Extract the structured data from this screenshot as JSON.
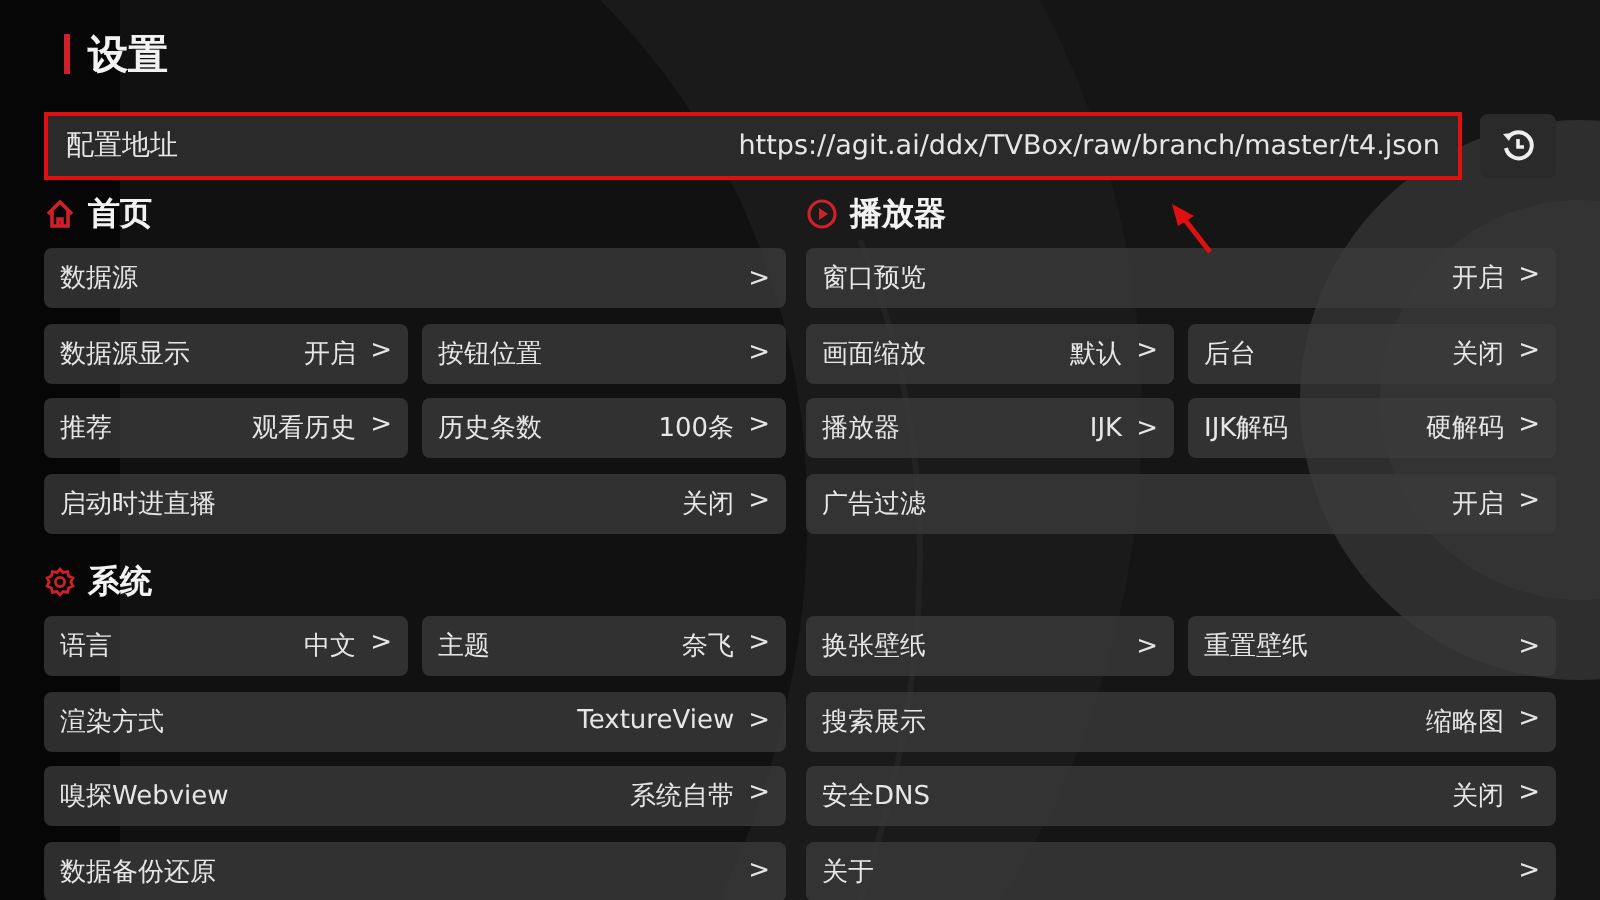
{
  "title": "设置",
  "config": {
    "label": "配置地址",
    "value": "https://agit.ai/ddx/TVBox/raw/branch/master/t4.json",
    "highlighted": true
  },
  "sections": [
    {
      "columns": [
        {
          "heading": {
            "kind": "home",
            "title": "首页"
          },
          "rows": [
            [
              {
                "label": "数据源",
                "arrow": ">"
              }
            ],
            [
              {
                "label": "数据源显示",
                "value": "开启",
                "arrow": ">"
              },
              {
                "label": "按钮位置",
                "arrow": ">"
              }
            ],
            [
              {
                "label": "推荐",
                "value": "观看历史",
                "arrow": ">"
              },
              {
                "label": "历史条数",
                "value": "100条",
                "arrow": ">"
              }
            ],
            [
              {
                "label": "启动时进直播",
                "value": "关闭",
                "arrow": ">"
              }
            ]
          ]
        },
        {
          "heading": {
            "kind": "play",
            "title": "播放器"
          },
          "rows": [
            [
              {
                "label": "窗口预览",
                "value": "开启",
                "arrow": ">"
              }
            ],
            [
              {
                "label": "画面缩放",
                "value": "默认",
                "arrow": ">"
              },
              {
                "label": "后台",
                "value": "关闭",
                "arrow": ">"
              }
            ],
            [
              {
                "label": "播放器",
                "value": "IJK",
                "arrow": ">"
              },
              {
                "label": "IJK解码",
                "value": "硬解码",
                "arrow": ">"
              }
            ],
            [
              {
                "label": "广告过滤",
                "value": "开启",
                "arrow": ">"
              }
            ]
          ]
        }
      ]
    },
    {
      "columns": [
        {
          "heading": {
            "kind": "gear",
            "title": "系统"
          },
          "rows": [
            [
              {
                "label": "语言",
                "value": "中文",
                "arrow": ">"
              },
              {
                "label": "主题",
                "value": "奈飞",
                "arrow": ">"
              }
            ],
            [
              {
                "label": "渲染方式",
                "value": "TextureView",
                "arrow": ">"
              }
            ],
            [
              {
                "label": "嗅探Webview",
                "value": "系统自带",
                "arrow": ">"
              }
            ],
            [
              {
                "label": "数据备份还原",
                "arrow": ">"
              }
            ]
          ]
        },
        {
          "rows": [
            [
              {
                "label": "换张壁纸",
                "arrow": ">"
              },
              {
                "label": "重置壁纸",
                "arrow": ">"
              }
            ],
            [
              {
                "label": "搜索展示",
                "value": "缩略图",
                "arrow": ">"
              }
            ],
            [
              {
                "label": "安全DNS",
                "value": "关闭",
                "arrow": ">"
              }
            ],
            [
              {
                "label": "关于",
                "arrow": ">"
              }
            ]
          ]
        }
      ]
    }
  ]
}
